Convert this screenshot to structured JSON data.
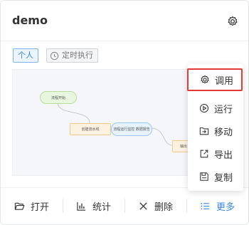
{
  "card": {
    "title": "demo",
    "tags": {
      "personal": "个人",
      "timer": "定时执行"
    },
    "flow_nodes": [
      "流程开始",
      "创建流水线",
      "流程运行监控 数据报告",
      "输出"
    ]
  },
  "actions": {
    "open": "打开",
    "stats": "统计",
    "delete": "删除",
    "more": "更多"
  },
  "menu": {
    "items": [
      "调用",
      "运行",
      "移动",
      "导出",
      "复制"
    ]
  },
  "colors": {
    "accent": "#3b86e6",
    "highlight_border": "#e53935"
  }
}
